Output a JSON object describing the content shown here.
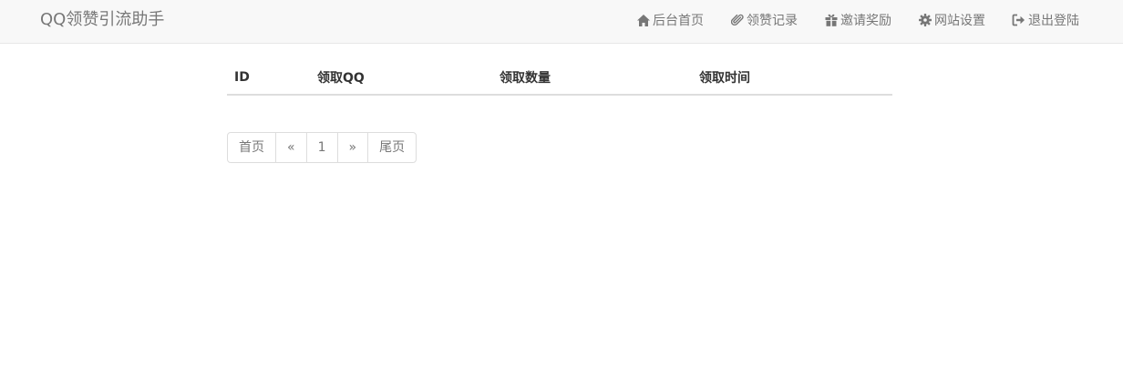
{
  "navbar": {
    "brand": "QQ领赞引流助手",
    "items": [
      {
        "label": "后台首页",
        "icon": "home-icon"
      },
      {
        "label": "领赞记录",
        "icon": "paperclip-icon"
      },
      {
        "label": "邀请奖励",
        "icon": "gift-icon"
      },
      {
        "label": "网站设置",
        "icon": "gear-icon"
      },
      {
        "label": "退出登陆",
        "icon": "logout-icon"
      }
    ]
  },
  "table": {
    "headers": [
      "ID",
      "领取QQ",
      "领取数量",
      "领取时间"
    ],
    "rows": []
  },
  "pagination": {
    "first": "首页",
    "prev": "«",
    "current": "1",
    "next": "»",
    "last": "尾页"
  },
  "colors": {
    "navbar_bg": "#f8f8f8",
    "nav_text": "#777777",
    "border": "#dddddd"
  }
}
